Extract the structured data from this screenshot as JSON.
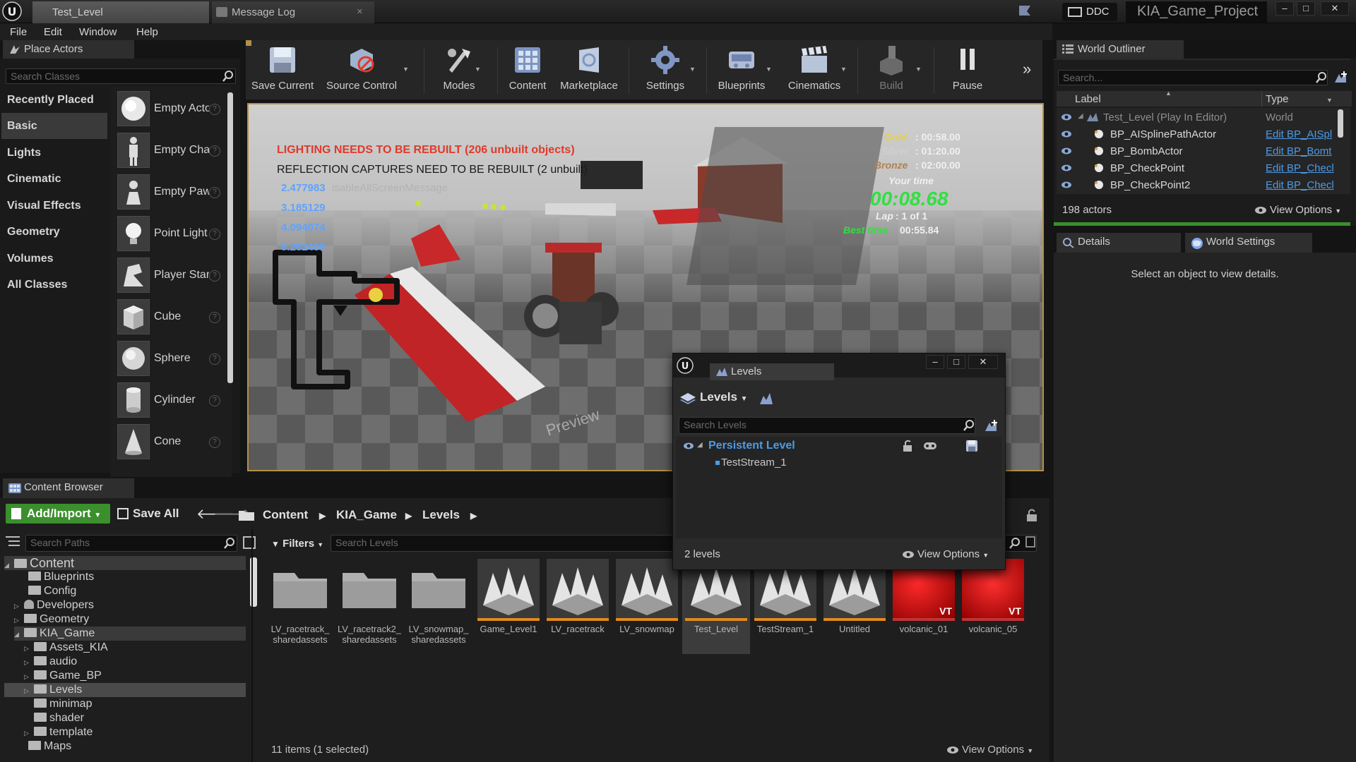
{
  "titlebar": {
    "tabs": [
      {
        "label": "Test_Level"
      },
      {
        "label": "Message Log"
      }
    ],
    "ddc": "DDC",
    "project": "KIA_Game_Project",
    "win_min": "–",
    "win_max": "□",
    "win_close": "✕"
  },
  "menubar": [
    "File",
    "Edit",
    "Window",
    "Help"
  ],
  "place_actors": {
    "tab": "Place Actors",
    "search_placeholder": "Search Classes",
    "categories": [
      "Recently Placed",
      "Basic",
      "Lights",
      "Cinematic",
      "Visual Effects",
      "Geometry",
      "Volumes",
      "All Classes"
    ],
    "selected_category": "Basic",
    "actors": [
      "Empty Actor",
      "Empty Character",
      "Empty Pawn",
      "Point Light",
      "Player Start",
      "Cube",
      "Sphere",
      "Cylinder",
      "Cone"
    ]
  },
  "toolbar": [
    "Save Current",
    "Source Control",
    "Modes",
    "Content",
    "Marketplace",
    "Settings",
    "Blueprints",
    "Cinematics",
    "Build",
    "Pause"
  ],
  "viewport": {
    "warning1": "LIGHTING NEEDS TO BE REBUILT (206 unbuilt objects)",
    "warning2": "REFLECTION CAPTURES NEED TO BE REBUILT (2 unbuilt)",
    "stats": [
      "2.477983",
      "3.185129",
      "4.094074",
      "5.262405"
    ],
    "ghost_text": "isableAllScreenMessage",
    "hud": {
      "gold_label": "Gold",
      "gold": ": 00:58.00",
      "silver_label": "Silver",
      "silver": ": 01:20.00",
      "bronze_label": "Bronze",
      "bronze": ": 02:00.00",
      "your_time_label": "Your time",
      "your_time": "00:08.68",
      "lap_label": "Lap",
      "lap": ": 1 of 1",
      "best_label": "Best time",
      "best": "00:55.84"
    },
    "preview_text": "Preview"
  },
  "outliner": {
    "tab": "World Outliner",
    "search_placeholder": "Search...",
    "col_label": "Label",
    "col_type": "Type",
    "rows": [
      {
        "label": "Test_Level (Play In Editor)",
        "type": "World"
      },
      {
        "label": "BP_AISplinePathActor",
        "type": "Edit BP_AISpl"
      },
      {
        "label": "BP_BombActor",
        "type": "Edit BP_Bomt"
      },
      {
        "label": "BP_CheckPoint",
        "type": "Edit BP_Checl"
      },
      {
        "label": "BP_CheckPoint2",
        "type": "Edit BP_Checl"
      }
    ],
    "count": "198 actors",
    "view_options": "View Options"
  },
  "details": {
    "tab1": "Details",
    "tab2": "World Settings",
    "empty_message": "Select an object to view details."
  },
  "content_browser": {
    "tab": "Content Browser",
    "add_import": "Add/Import",
    "save_all": "Save All",
    "breadcrumb": [
      "Content",
      "KIA_Game",
      "Levels"
    ],
    "search_paths_placeholder": "Search Paths",
    "filters": "Filters",
    "search_assets_placeholder": "Search Levels",
    "tree": [
      {
        "label": "Content",
        "indent": 0,
        "expander": "◢"
      },
      {
        "label": "Blueprints",
        "indent": 1,
        "expander": ""
      },
      {
        "label": "Config",
        "indent": 1,
        "expander": ""
      },
      {
        "label": "Developers",
        "indent": 1,
        "expander": "▷"
      },
      {
        "label": "Geometry",
        "indent": 1,
        "expander": "▷"
      },
      {
        "label": "KIA_Game",
        "indent": 1,
        "expander": "◢"
      },
      {
        "label": "Assets_KIA",
        "indent": 2,
        "expander": "▷"
      },
      {
        "label": "audio",
        "indent": 2,
        "expander": "▷"
      },
      {
        "label": "Game_BP",
        "indent": 2,
        "expander": "▷"
      },
      {
        "label": "Levels",
        "indent": 2,
        "expander": "▷"
      },
      {
        "label": "minimap",
        "indent": 2,
        "expander": ""
      },
      {
        "label": "shader",
        "indent": 2,
        "expander": ""
      },
      {
        "label": "template",
        "indent": 2,
        "expander": "▷"
      },
      {
        "label": "Maps",
        "indent": 1,
        "expander": ""
      }
    ],
    "selected_tree": "Levels",
    "assets": [
      {
        "label": "LV_racetrack_ sharedassets",
        "kind": "folder"
      },
      {
        "label": "LV_racetrack2_ sharedassets",
        "kind": "folder"
      },
      {
        "label": "LV_snowmap_ sharedassets",
        "kind": "folder"
      },
      {
        "label": "Game_Level1",
        "kind": "level"
      },
      {
        "label": "LV_racetrack",
        "kind": "level"
      },
      {
        "label": "LV_snowmap",
        "kind": "level"
      },
      {
        "label": "Test_Level",
        "kind": "level"
      },
      {
        "label": "TestStream_1",
        "kind": "level"
      },
      {
        "label": "Untitled",
        "kind": "level"
      },
      {
        "label": "volcanic_01",
        "kind": "texture"
      },
      {
        "label": "volcanic_05",
        "kind": "texture"
      }
    ],
    "vt_badge": "VT",
    "selected_asset": "Test_Level",
    "status": "11 items (1 selected)",
    "view_options": "View Options"
  },
  "levels_window": {
    "tab": "Levels",
    "dropdown": "Levels",
    "search_placeholder": "Search Levels",
    "persistent": "Persistent Level",
    "stream": "TestStream_1",
    "count": "2 levels",
    "view_options": "View Options"
  },
  "colors": {
    "accent_gold": "#b49148",
    "link_blue": "#4c9be8",
    "warning_red": "#e03a2a",
    "stat_blue": "#5fa3ff",
    "hud_green": "#30e040",
    "hud_yellow": "#e8d040",
    "add_green": "#3b8f2d"
  }
}
